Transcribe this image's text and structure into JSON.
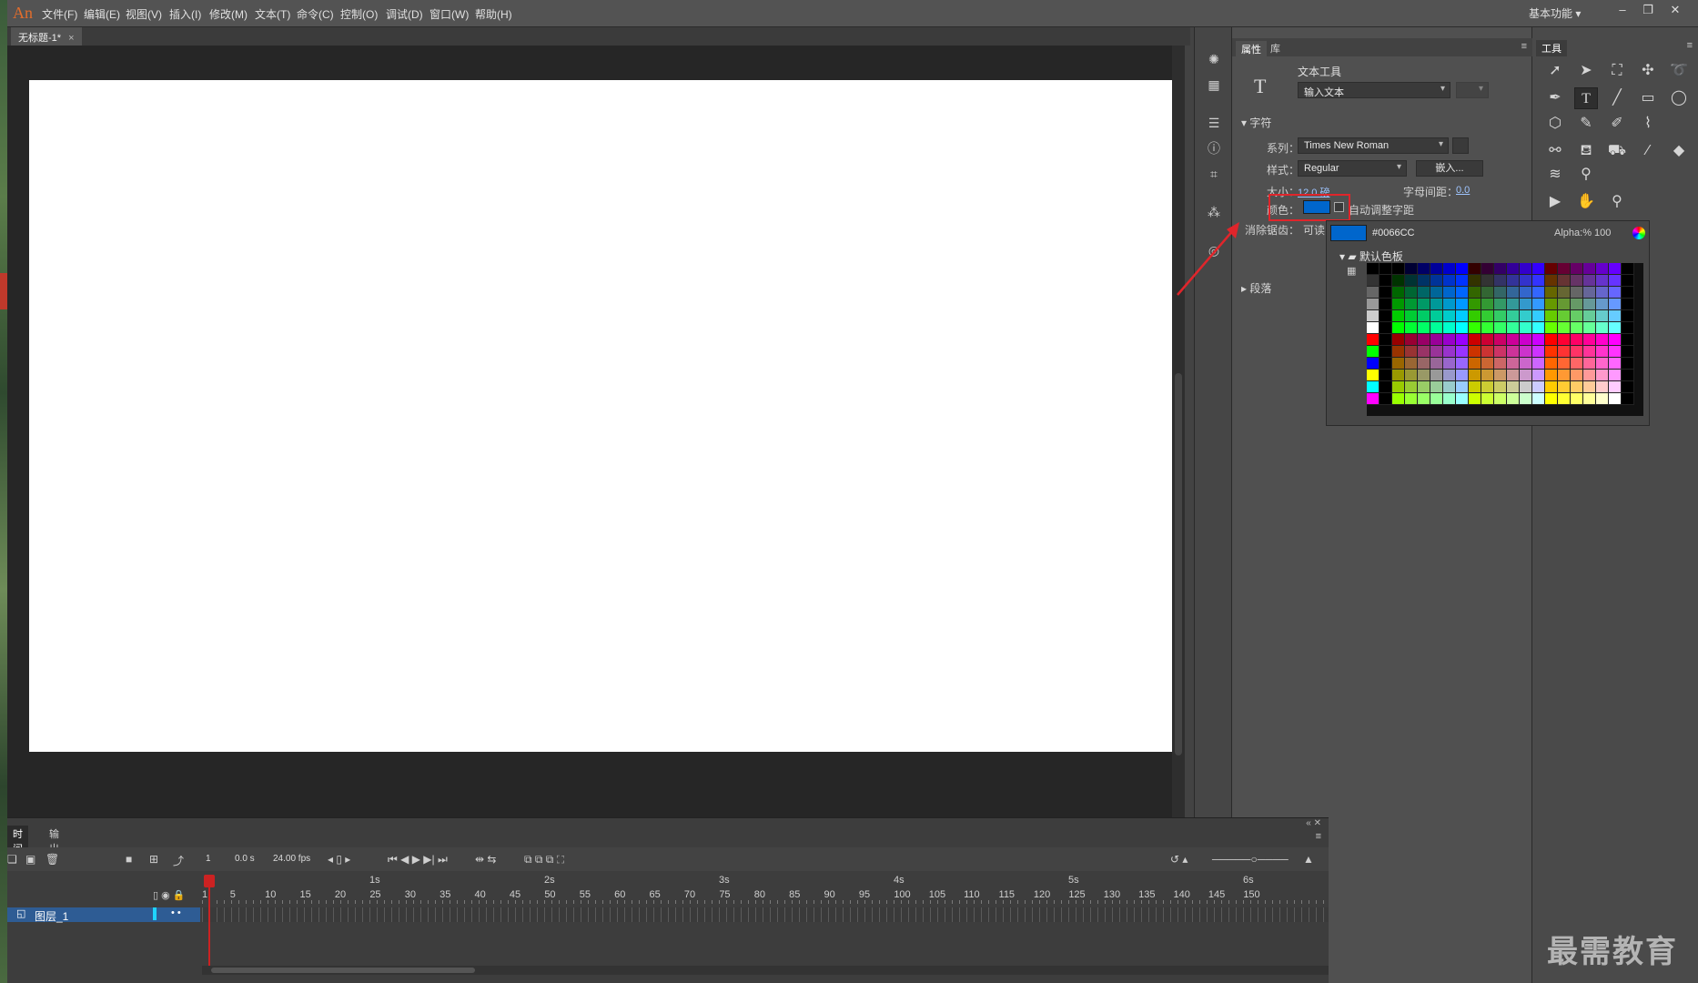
{
  "app": {
    "logo": "An",
    "workspace": "基本功能",
    "workspace_arrow": "▾"
  },
  "menu": [
    "文件(F)",
    "编辑(E)",
    "视图(V)",
    "插入(I)",
    "修改(M)",
    "文本(T)",
    "命令(C)",
    "控制(O)",
    "调试(D)",
    "窗口(W)",
    "帮助(H)"
  ],
  "window_controls": [
    "–",
    "❐",
    "✕"
  ],
  "document": {
    "tab": "无标题-1*",
    "close": "×"
  },
  "properties": {
    "tabs": [
      "属性",
      "库"
    ],
    "tool_icon": "T",
    "tool_name": "文本工具",
    "text_type": "输入文本",
    "character_section": "字符",
    "family_label": "系列：",
    "family": "Times New Roman",
    "style_label": "样式：",
    "style": "Regular",
    "embed": "嵌入...",
    "size_label": "大小：",
    "size": "12.0 磅",
    "spacing_label": "字母间距：",
    "spacing": "0.0",
    "color_label": "颜色：",
    "auto_kern": "自动调整字距",
    "aa_label": "消除锯齿：",
    "aa_value": "可读",
    "paragraph_section": "段落"
  },
  "picker": {
    "hex": "#0066CC",
    "alpha_label": "Alpha:%",
    "alpha_value": "100",
    "folder": "默认色板",
    "selected_color": "#0066CC"
  },
  "tools_panel": {
    "tab": "工具"
  },
  "timeline": {
    "tabs": [
      "时间轴",
      "输出"
    ],
    "current_frame": "1",
    "elapsed": "0.0 s",
    "fps": "24.00 fps",
    "seconds": [
      "1s",
      "2s",
      "3s",
      "4s",
      "5s",
      "6s"
    ],
    "frames": [
      "1",
      "5",
      "10",
      "15",
      "20",
      "25",
      "30",
      "35",
      "40",
      "45",
      "50",
      "55",
      "60",
      "65",
      "70",
      "75",
      "80",
      "85",
      "90",
      "95",
      "100",
      "105",
      "110",
      "115",
      "120",
      "125",
      "130",
      "135",
      "140",
      "145",
      "150"
    ],
    "layer": "图层_1"
  },
  "watermark": "最需教育"
}
